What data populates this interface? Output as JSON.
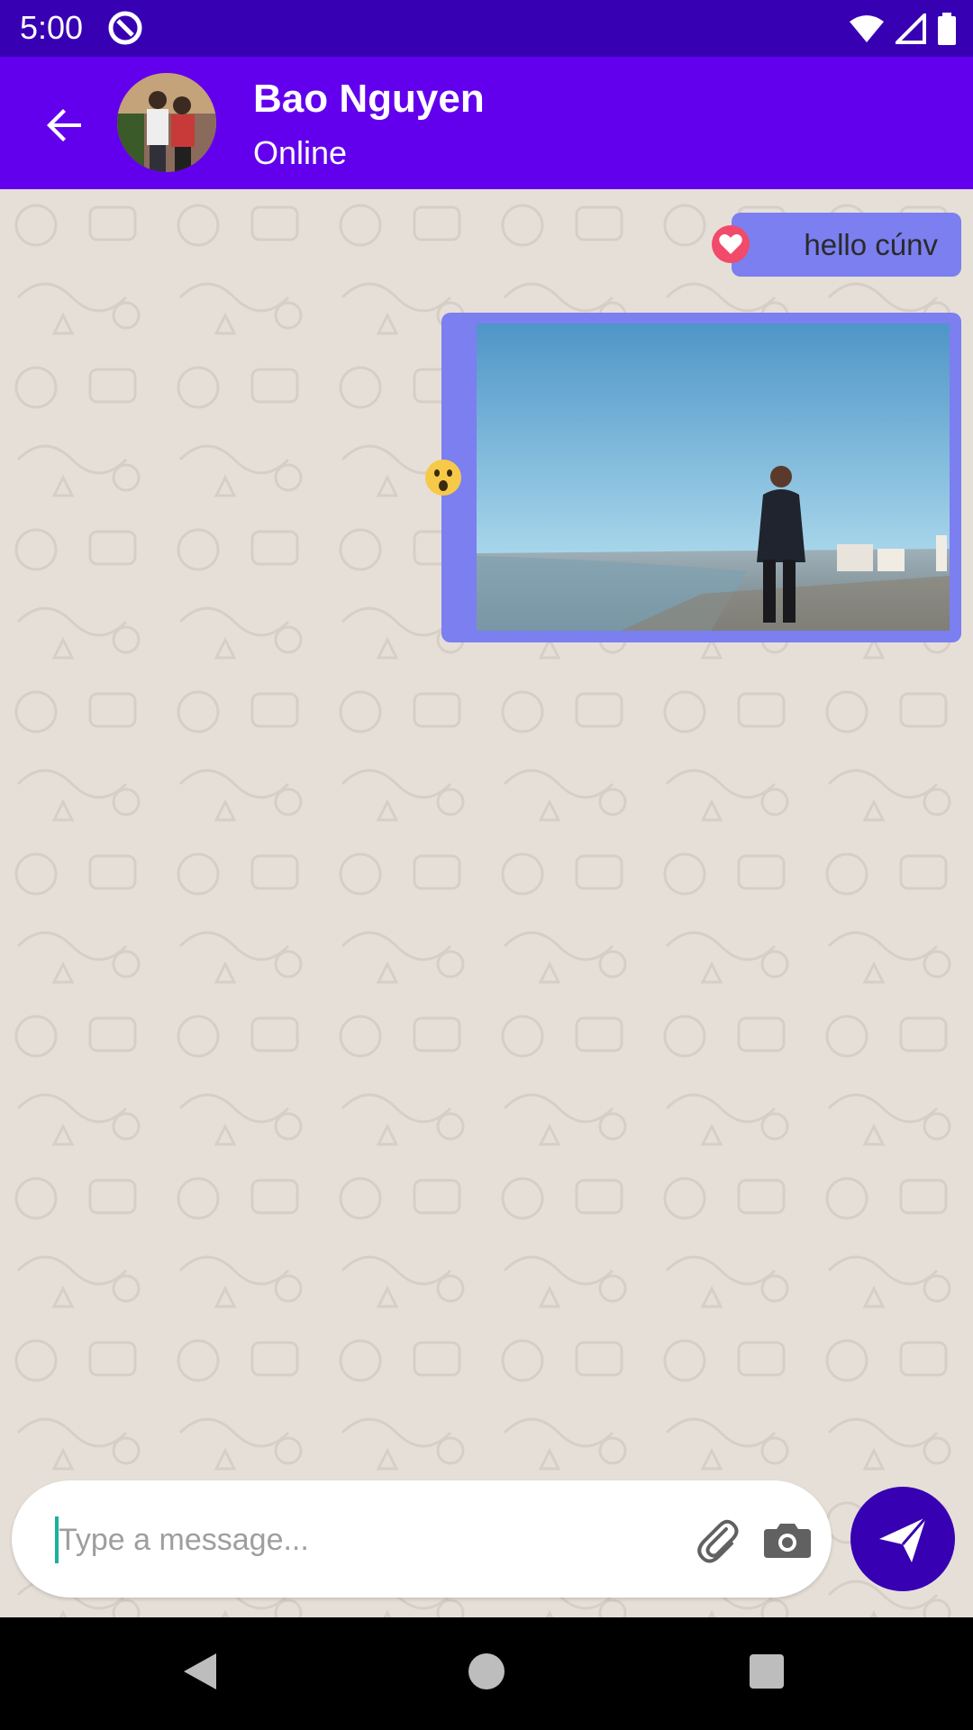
{
  "status_bar": {
    "time": "5:00"
  },
  "header": {
    "contact_name": "Bao Nguyen",
    "contact_status": "Online"
  },
  "messages": [
    {
      "type": "text",
      "text": "hello cúnv",
      "reaction": "heart"
    },
    {
      "type": "image",
      "reaction": "wow"
    }
  ],
  "composer": {
    "placeholder": "Type a message..."
  },
  "colors": {
    "status_bar": "#3700b3",
    "app_bar": "#6200ee",
    "bubble": "#7b7ff0",
    "send_button": "#3700b3",
    "chat_background": "#e6dfd8"
  }
}
